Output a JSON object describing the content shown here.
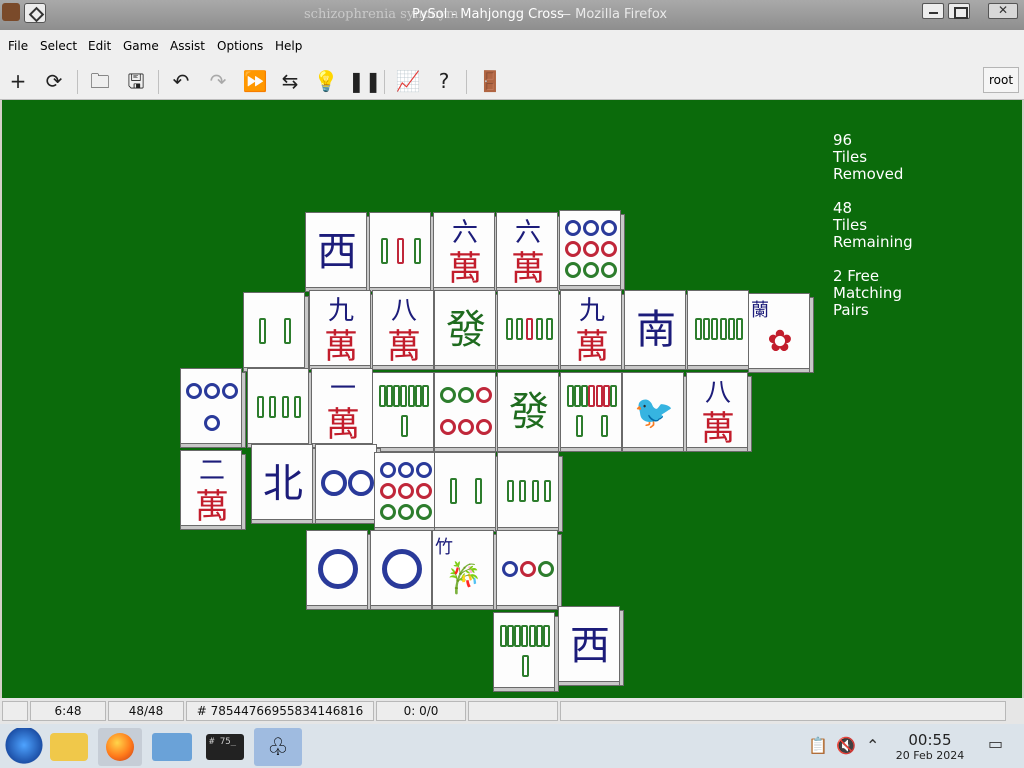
{
  "window": {
    "title": "PySol - Mahjongg Cross",
    "title_suffix": "— Mozilla Firefox",
    "ghost_title": "schizophrenia synonym"
  },
  "menu": [
    "File",
    "Select",
    "Edit",
    "Game",
    "Assist",
    "Options",
    "Help"
  ],
  "toolbar": {
    "buttons": [
      "new-game",
      "restart",
      "open",
      "save",
      "undo",
      "redo",
      "autodrop",
      "shuffle",
      "hint",
      "pause",
      "statistics",
      "rules",
      "quit"
    ],
    "user_label": "root"
  },
  "stats": {
    "removed": {
      "value": "96",
      "line1": "Tiles",
      "line2": "Removed"
    },
    "remaining": {
      "value": "48",
      "line1": "Tiles",
      "line2": "Remaining"
    },
    "pairs": {
      "value": "2 Free",
      "line1": "Matching",
      "line2": "Pairs"
    }
  },
  "tiles": [
    {
      "kind": "char",
      "top": "西",
      "color": "blue"
    },
    {
      "kind": "bamboo",
      "detail": "bamboo-3"
    },
    {
      "kind": "wan",
      "top": "六",
      "bottom": "萬"
    },
    {
      "kind": "wan",
      "top": "六",
      "bottom": "萬"
    },
    {
      "kind": "dots",
      "detail": "circle-9"
    },
    {
      "kind": "bamboo",
      "detail": "bamboo-2"
    },
    {
      "kind": "wan",
      "top": "九",
      "bottom": "萬"
    },
    {
      "kind": "wan",
      "top": "八",
      "bottom": "萬"
    },
    {
      "kind": "char",
      "top": "發",
      "color": "green"
    },
    {
      "kind": "bamboo",
      "detail": "bamboo-5"
    },
    {
      "kind": "wan",
      "top": "九",
      "bottom": "萬"
    },
    {
      "kind": "char",
      "top": "南",
      "color": "blue"
    },
    {
      "kind": "bamboo",
      "detail": "bamboo-6"
    },
    {
      "kind": "flower",
      "top": "蘭",
      "detail": "orchid"
    },
    {
      "kind": "dots",
      "detail": "circle-4"
    },
    {
      "kind": "bamboo",
      "detail": "bamboo-4"
    },
    {
      "kind": "wan",
      "top": "一",
      "bottom": "萬"
    },
    {
      "kind": "bamboo",
      "detail": "bamboo-8"
    },
    {
      "kind": "dots",
      "detail": "circle-6"
    },
    {
      "kind": "char",
      "top": "發",
      "color": "green"
    },
    {
      "kind": "bamboo",
      "detail": "bamboo-9"
    },
    {
      "kind": "bamboo",
      "detail": "bamboo-1"
    },
    {
      "kind": "wan",
      "top": "八",
      "bottom": "萬"
    },
    {
      "kind": "wan",
      "top": "二",
      "bottom": "萬"
    },
    {
      "kind": "char",
      "top": "北",
      "color": "blue"
    },
    {
      "kind": "dots",
      "detail": "circle-2"
    },
    {
      "kind": "dots",
      "detail": "circle-9"
    },
    {
      "kind": "bamboo",
      "detail": "bamboo-2"
    },
    {
      "kind": "bamboo",
      "detail": "bamboo-4"
    },
    {
      "kind": "dots",
      "detail": "circle-1"
    },
    {
      "kind": "dots",
      "detail": "circle-1"
    },
    {
      "kind": "flower",
      "top": "竹",
      "detail": "bamboo-season"
    },
    {
      "kind": "dots",
      "detail": "circle-3"
    },
    {
      "kind": "bamboo",
      "detail": "bamboo-8"
    },
    {
      "kind": "char",
      "top": "西",
      "color": "blue"
    }
  ],
  "status": {
    "time": "6:48",
    "moves": "48/48",
    "game_number": "# 78544766955834146816",
    "score": "0: 0/0"
  },
  "taskbar": {
    "clock_time": "00:55",
    "clock_date": "20 Feb 2024",
    "terminal_text": "# 75_"
  }
}
